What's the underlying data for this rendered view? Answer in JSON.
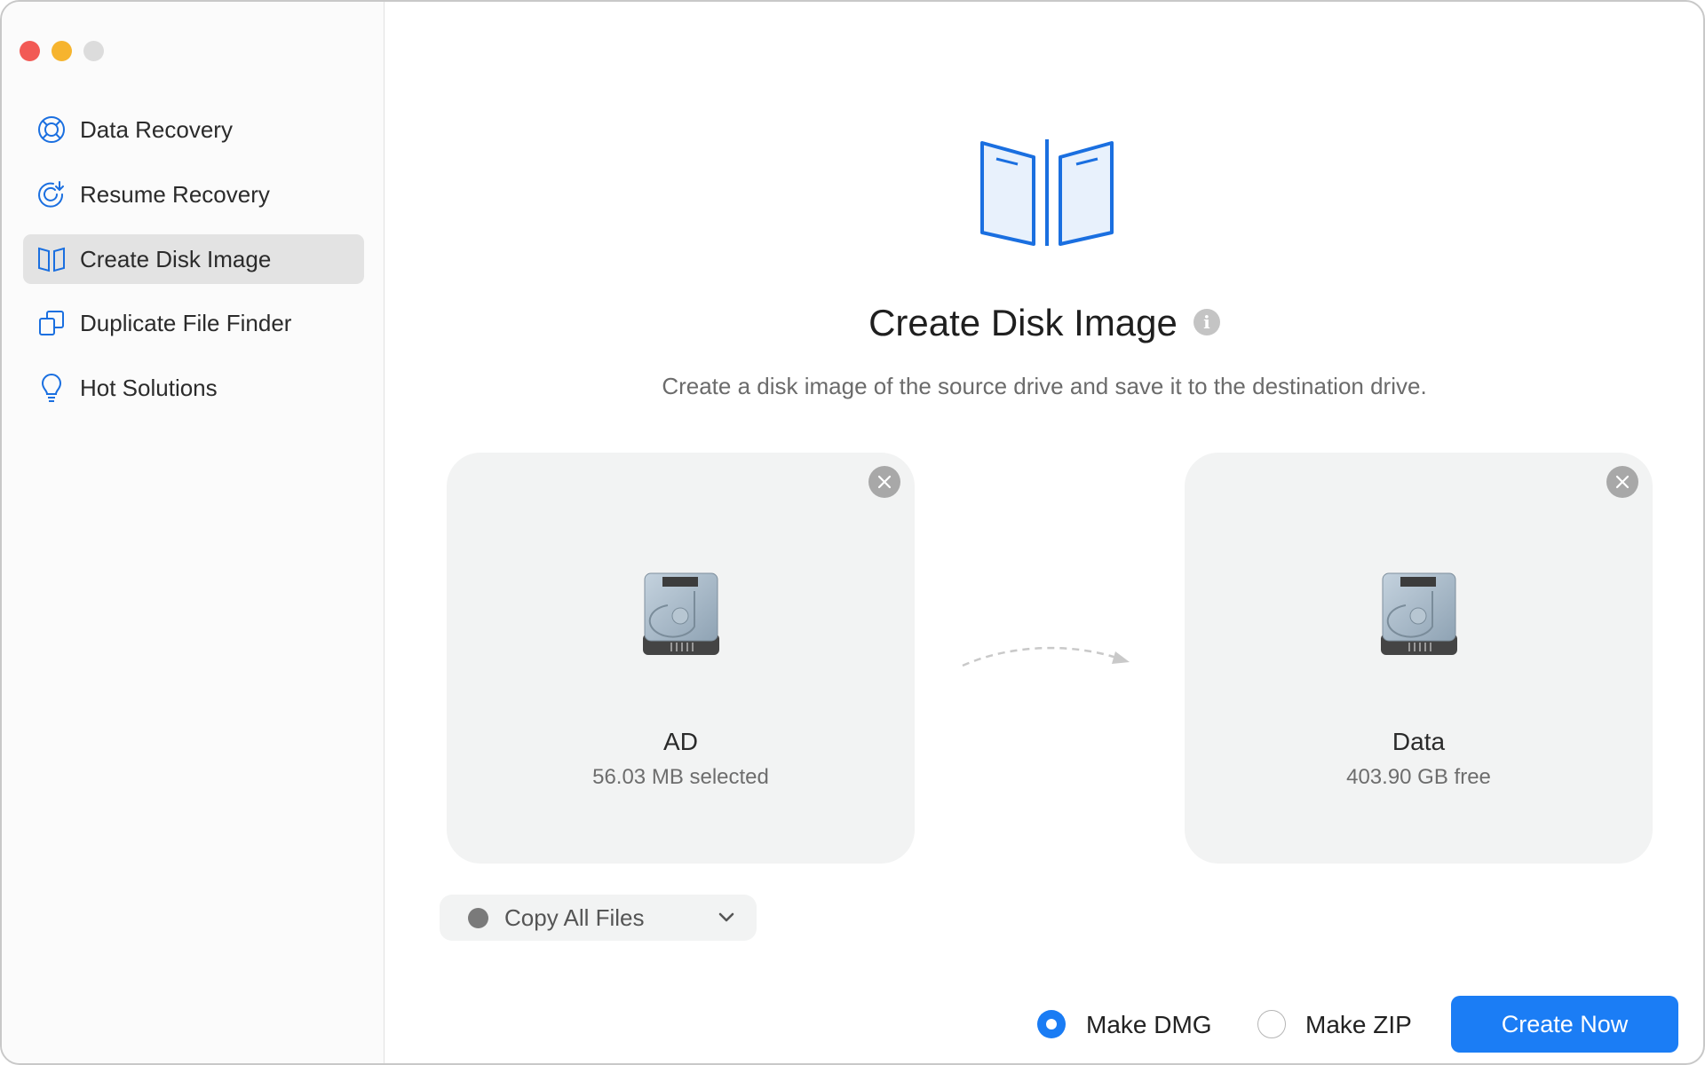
{
  "window_controls": {
    "close": "#f25a55",
    "minimize": "#f6b42e",
    "zoom": "#dcdcdc"
  },
  "sidebar": {
    "items": [
      {
        "label": "Data Recovery",
        "icon": "lifebuoy-icon"
      },
      {
        "label": "Resume Recovery",
        "icon": "resume-icon"
      },
      {
        "label": "Create Disk Image",
        "icon": "disk-image-icon",
        "selected": true
      },
      {
        "label": "Duplicate File Finder",
        "icon": "duplicate-icon"
      },
      {
        "label": "Hot Solutions",
        "icon": "lightbulb-icon"
      }
    ]
  },
  "main": {
    "title": "Create Disk Image",
    "info_glyph": "i",
    "subtitle": "Create a disk image of the source drive and save it to the destination drive.",
    "source": {
      "name": "AD",
      "detail": "56.03 MB selected"
    },
    "destination": {
      "name": "Data",
      "detail": "403.90 GB free"
    },
    "copy_mode": "Copy All Files",
    "options": {
      "dmg": "Make DMG",
      "zip": "Make ZIP",
      "selected": "dmg"
    },
    "create_button": "Create Now"
  },
  "colors": {
    "accent": "#1a7cf4"
  }
}
